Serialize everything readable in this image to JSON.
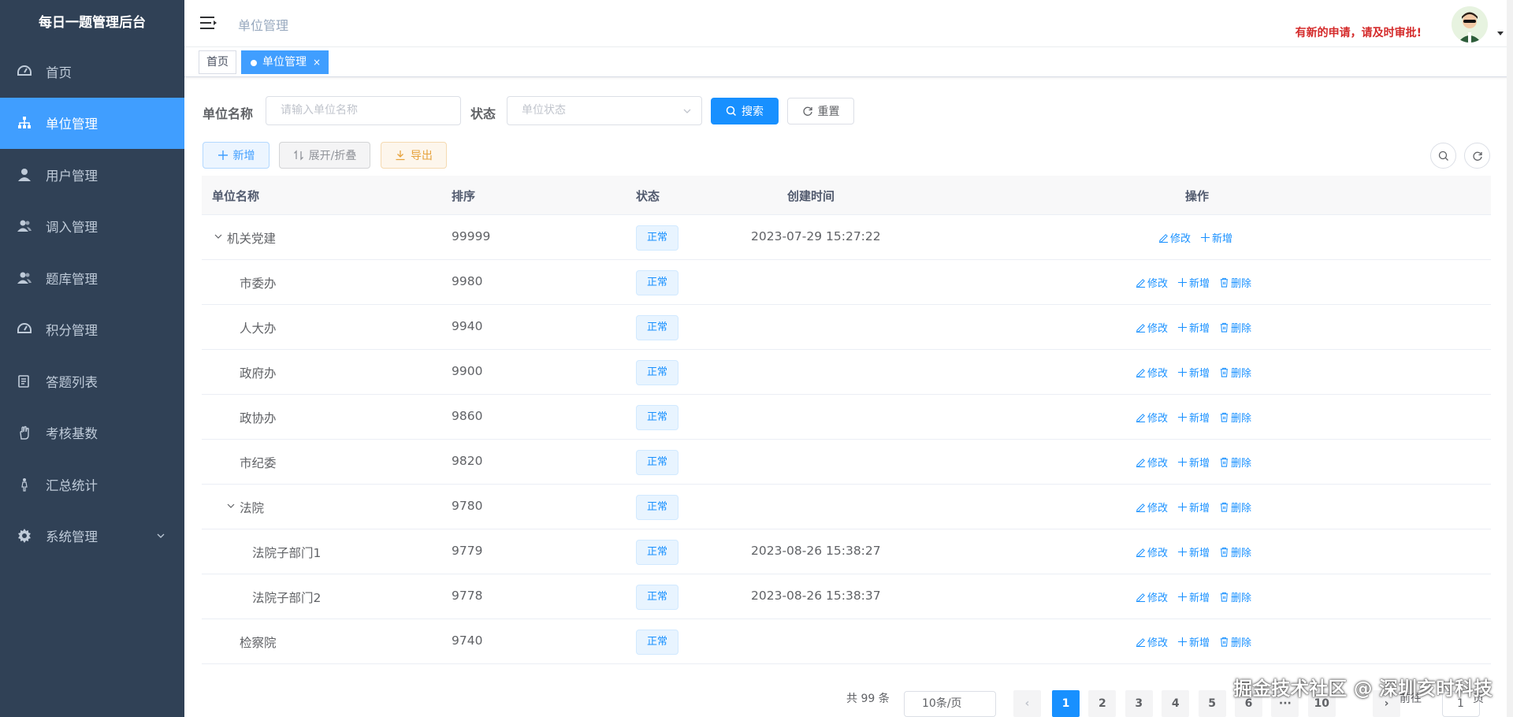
{
  "app": {
    "title": "每日一题管理后台"
  },
  "sidebar": {
    "items": [
      {
        "label": "首页",
        "icon": "dashboard-icon",
        "active": false
      },
      {
        "label": "单位管理",
        "icon": "tree-org-icon",
        "active": true
      },
      {
        "label": "用户管理",
        "icon": "user-icon",
        "active": false
      },
      {
        "label": "调入管理",
        "icon": "peoples-icon",
        "active": false
      },
      {
        "label": "题库管理",
        "icon": "peoples-icon",
        "active": false
      },
      {
        "label": "积分管理",
        "icon": "dashboard-icon",
        "active": false
      },
      {
        "label": "答题列表",
        "icon": "list-icon",
        "active": false
      },
      {
        "label": "考核基数",
        "icon": "hand-icon",
        "active": false
      },
      {
        "label": "汇总统计",
        "icon": "person-icon",
        "active": false
      },
      {
        "label": "系统管理",
        "icon": "gear-icon",
        "active": false,
        "expandable": true
      }
    ]
  },
  "navbar": {
    "breadcrumb": "单位管理",
    "notice": "有新的申请，请及时审批!"
  },
  "tags": {
    "home": "首页",
    "current": "单位管理",
    "close": "×"
  },
  "search": {
    "name_label": "单位名称",
    "name_placeholder": "请输入单位名称",
    "status_label": "状态",
    "status_placeholder": "单位状态",
    "search_btn": "搜索",
    "reset_btn": "重置"
  },
  "toolbar": {
    "add_btn": "新增",
    "expand_btn": "展开/折叠",
    "export_btn": "导出"
  },
  "table": {
    "headers": [
      "单位名称",
      "排序",
      "状态",
      "创建时间",
      "操作"
    ],
    "rows": [
      {
        "name": "机关党建",
        "order": "99999",
        "status": "正常",
        "created": "2023-07-29 15:27:22",
        "level": 0,
        "expand": true,
        "ops": [
          "修改",
          "新增"
        ]
      },
      {
        "name": "市委办",
        "order": "9980",
        "status": "正常",
        "created": "",
        "level": 1,
        "expand": false,
        "ops": [
          "修改",
          "新增",
          "删除"
        ]
      },
      {
        "name": "人大办",
        "order": "9940",
        "status": "正常",
        "created": "",
        "level": 1,
        "expand": false,
        "ops": [
          "修改",
          "新增",
          "删除"
        ]
      },
      {
        "name": "政府办",
        "order": "9900",
        "status": "正常",
        "created": "",
        "level": 1,
        "expand": false,
        "ops": [
          "修改",
          "新增",
          "删除"
        ]
      },
      {
        "name": "政协办",
        "order": "9860",
        "status": "正常",
        "created": "",
        "level": 1,
        "expand": false,
        "ops": [
          "修改",
          "新增",
          "删除"
        ]
      },
      {
        "name": "市纪委",
        "order": "9820",
        "status": "正常",
        "created": "",
        "level": 1,
        "expand": false,
        "ops": [
          "修改",
          "新增",
          "删除"
        ]
      },
      {
        "name": "法院",
        "order": "9780",
        "status": "正常",
        "created": "",
        "level": 1,
        "expand": true,
        "ops": [
          "修改",
          "新增",
          "删除"
        ]
      },
      {
        "name": "法院子部门1",
        "order": "9779",
        "status": "正常",
        "created": "2023-08-26 15:38:27",
        "level": 2,
        "expand": false,
        "ops": [
          "修改",
          "新增",
          "删除"
        ]
      },
      {
        "name": "法院子部门2",
        "order": "9778",
        "status": "正常",
        "created": "2023-08-26 15:38:37",
        "level": 2,
        "expand": false,
        "ops": [
          "修改",
          "新增",
          "删除"
        ]
      },
      {
        "name": "检察院",
        "order": "9740",
        "status": "正常",
        "created": "",
        "level": 1,
        "expand": false,
        "ops": [
          "修改",
          "新增",
          "删除"
        ]
      }
    ]
  },
  "pagination": {
    "total": "共 99 条",
    "page_size": "10条/页",
    "pages": [
      "1",
      "2",
      "3",
      "4",
      "5",
      "6",
      "···",
      "10"
    ],
    "current": "1",
    "goto_label": "前往",
    "goto_value": "1",
    "goto_suffix": "页"
  },
  "watermark": "掘金技术社区 @ 深圳亥时科技",
  "colors": {
    "sidebar": "#304156",
    "accent": "#409eff",
    "primary": "#1890ff",
    "notice": "#d42a2a"
  }
}
